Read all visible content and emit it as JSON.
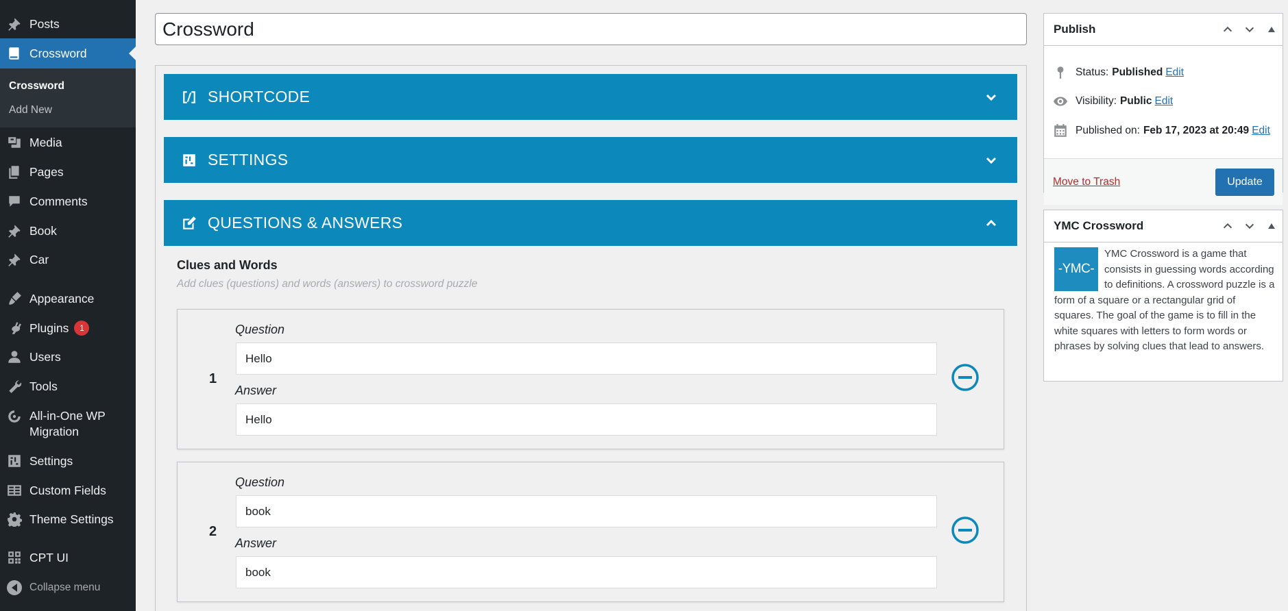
{
  "sidebar": {
    "items": [
      {
        "label": "Posts",
        "icon": "pin-icon"
      },
      {
        "label": "Crossword",
        "icon": "book-icon"
      },
      {
        "label": "Media",
        "icon": "media-icon"
      },
      {
        "label": "Pages",
        "icon": "pages-icon"
      },
      {
        "label": "Comments",
        "icon": "comments-icon"
      },
      {
        "label": "Book",
        "icon": "pin-icon"
      },
      {
        "label": "Car",
        "icon": "pin-icon"
      },
      {
        "label": "Appearance",
        "icon": "brush-icon"
      },
      {
        "label": "Plugins",
        "icon": "plugin-icon",
        "badge": "1"
      },
      {
        "label": "Users",
        "icon": "users-icon"
      },
      {
        "label": "Tools",
        "icon": "wrench-icon"
      },
      {
        "label": "All-in-One WP Migration",
        "icon": "migration-icon"
      },
      {
        "label": "Settings",
        "icon": "settings-icon"
      },
      {
        "label": "Custom Fields",
        "icon": "fields-icon"
      },
      {
        "label": "Theme Settings",
        "icon": "gear-icon"
      },
      {
        "label": "CPT UI",
        "icon": "grid-icon"
      }
    ],
    "submenu": [
      "Crossword",
      "Add New"
    ],
    "collapse_label": "Collapse menu"
  },
  "post_title": "Crossword",
  "sections": [
    {
      "title": "SHORTCODE",
      "icon": "shortcode-icon",
      "expanded": false
    },
    {
      "title": "SETTINGS",
      "icon": "settings-icon",
      "expanded": false
    },
    {
      "title": "QUESTIONS & ANSWERS",
      "icon": "edit-icon",
      "expanded": true
    }
  ],
  "clues": {
    "title": "Clues and Words",
    "subtitle": "Add clues (questions) and words (answers) to crossword puzzle",
    "question_label": "Question",
    "answer_label": "Answer",
    "rows": [
      {
        "num": "1",
        "question": "Hello",
        "answer": "Hello"
      },
      {
        "num": "2",
        "question": "book",
        "answer": "book"
      }
    ]
  },
  "publish": {
    "title": "Publish",
    "status_label": "Status:",
    "status_value": "Published",
    "visibility_label": "Visibility:",
    "visibility_value": "Public",
    "published_label": "Published on:",
    "published_value": "Feb 17, 2023 at 20:49",
    "edit_label": "Edit",
    "trash_label": "Move to Trash",
    "update_label": "Update"
  },
  "ymc": {
    "title": "YMC Crossword",
    "logo_text": "-YMC-",
    "description": "YMC Crossword is a game that consists in guessing words according to definitions. A crossword puzzle is a form of a square or a rectangular grid of squares. The goal of the game is to fill in the white squares with letters to form words or phrases by solving clues that lead to answers."
  },
  "colors": {
    "sidebar_bg": "#1d2327",
    "accent": "#2271b1",
    "accordion": "#0c88bb",
    "badge": "#d63638"
  }
}
